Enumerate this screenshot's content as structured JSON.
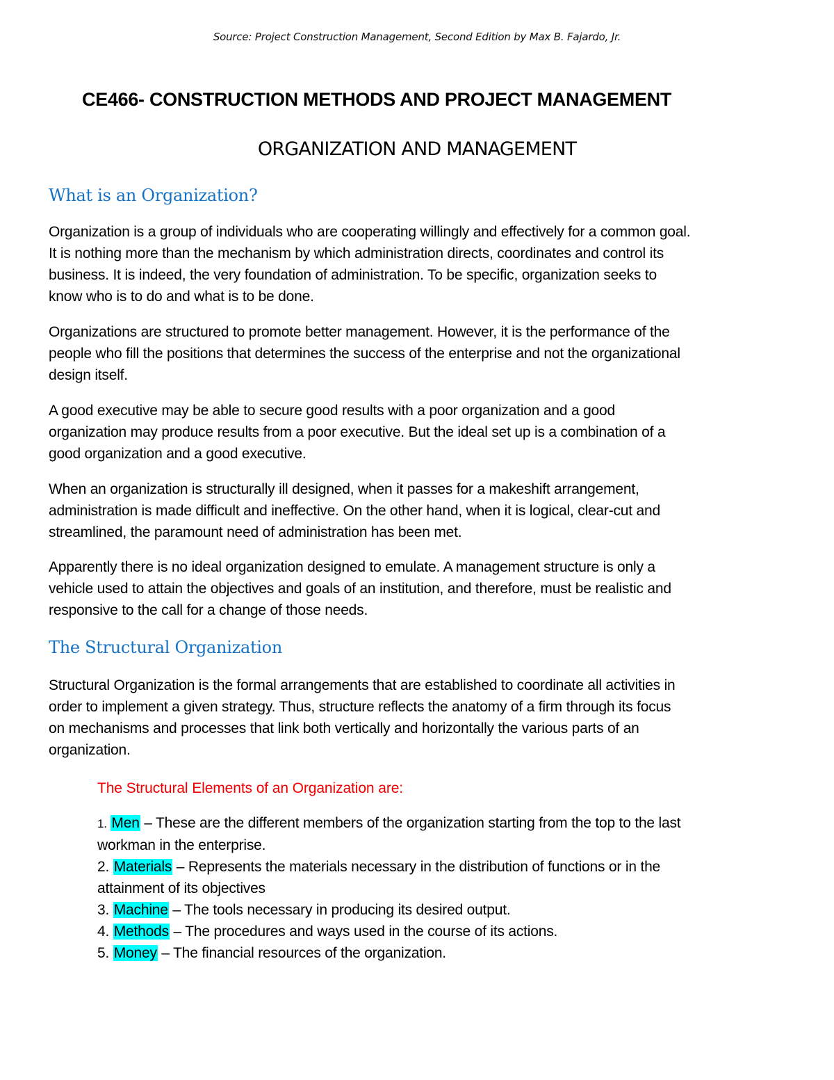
{
  "header": {
    "source": "Source: Project Construction Management, Second Edition by Max B. Fajardo, Jr."
  },
  "course_title": "CE466- CONSTRUCTION METHODS AND PROJECT MANAGEMENT",
  "doc_title": "ORGANIZATION AND MANAGEMENT",
  "sections": [
    {
      "heading": "What is an Organization?",
      "paragraphs": [
        {
          "lines": [
            "Organization is a group of individuals who are cooperating willingly and effectively for a common goal.",
            "It is nothing more than the mechanism by which administration directs, coordinates and control its",
            "business. It is indeed, the very foundation of administration. To be specific, organization seeks to",
            "know who is to do and what is to be done."
          ]
        },
        {
          "lines": [
            "Organizations are structured to promote better management. However, it is the performance of the",
            "people who fill the positions that determines the success of the enterprise and not the organizational",
            "design itself."
          ]
        },
        {
          "lines": [
            "A good executive may be able to secure good results with a poor organization and a good",
            "organization may produce results from a poor executive. But the ideal set up is a combination of a",
            "good organization and a good executive."
          ]
        },
        {
          "lines": [
            "When an organization is structurally ill designed, when it passes for a makeshift arrangement,",
            "administration is made difficult and ineffective. On the other hand, when it is logical, clear-cut and",
            "streamlined, the paramount need of administration has been met."
          ]
        },
        {
          "lines": [
            "Apparently there is no ideal organization designed to emulate. A management structure is only a",
            "vehicle used to attain the objectives and goals of an institution, and therefore, must be realistic and",
            "responsive to the call for a change of those needs."
          ]
        }
      ]
    },
    {
      "heading": "The Structural Organization",
      "paragraphs": [
        {
          "lines": [
            "Structural Organization is the formal arrangements that are established to coordinate all activities in",
            "order to implement a given strategy. Thus, structure reflects the anatomy of a firm through its focus",
            "on mechanisms and processes that link both vertically and horizontally the various parts of an",
            "organization."
          ]
        }
      ],
      "elements_heading": "The Structural Elements of an Organization are:",
      "elements": [
        {
          "num": "1.",
          "term": "Men",
          "desc": " – These are the different members of the organization starting from the top to the last",
          "cont": "workman in the enterprise."
        },
        {
          "num": "2.",
          "term": "Materials",
          "desc": " – Represents the materials necessary in the distribution of functions or in the",
          "cont": "attainment of its objectives"
        },
        {
          "num": "3.",
          "term": "Machine",
          "desc": " – The tools necessary in producing its desired output.",
          "cont": ""
        },
        {
          "num": "4.",
          "term": "Methods",
          "desc": " – The procedures and ways used in the course of its actions.",
          "cont": ""
        },
        {
          "num": "5.",
          "term": "Money",
          "desc": " – The financial resources of the organization.",
          "cont": ""
        }
      ]
    }
  ],
  "colors": {
    "heading_blue": "#1673c4",
    "elements_heading_red": "#f00000",
    "highlight_cyan": "#00ffff"
  }
}
